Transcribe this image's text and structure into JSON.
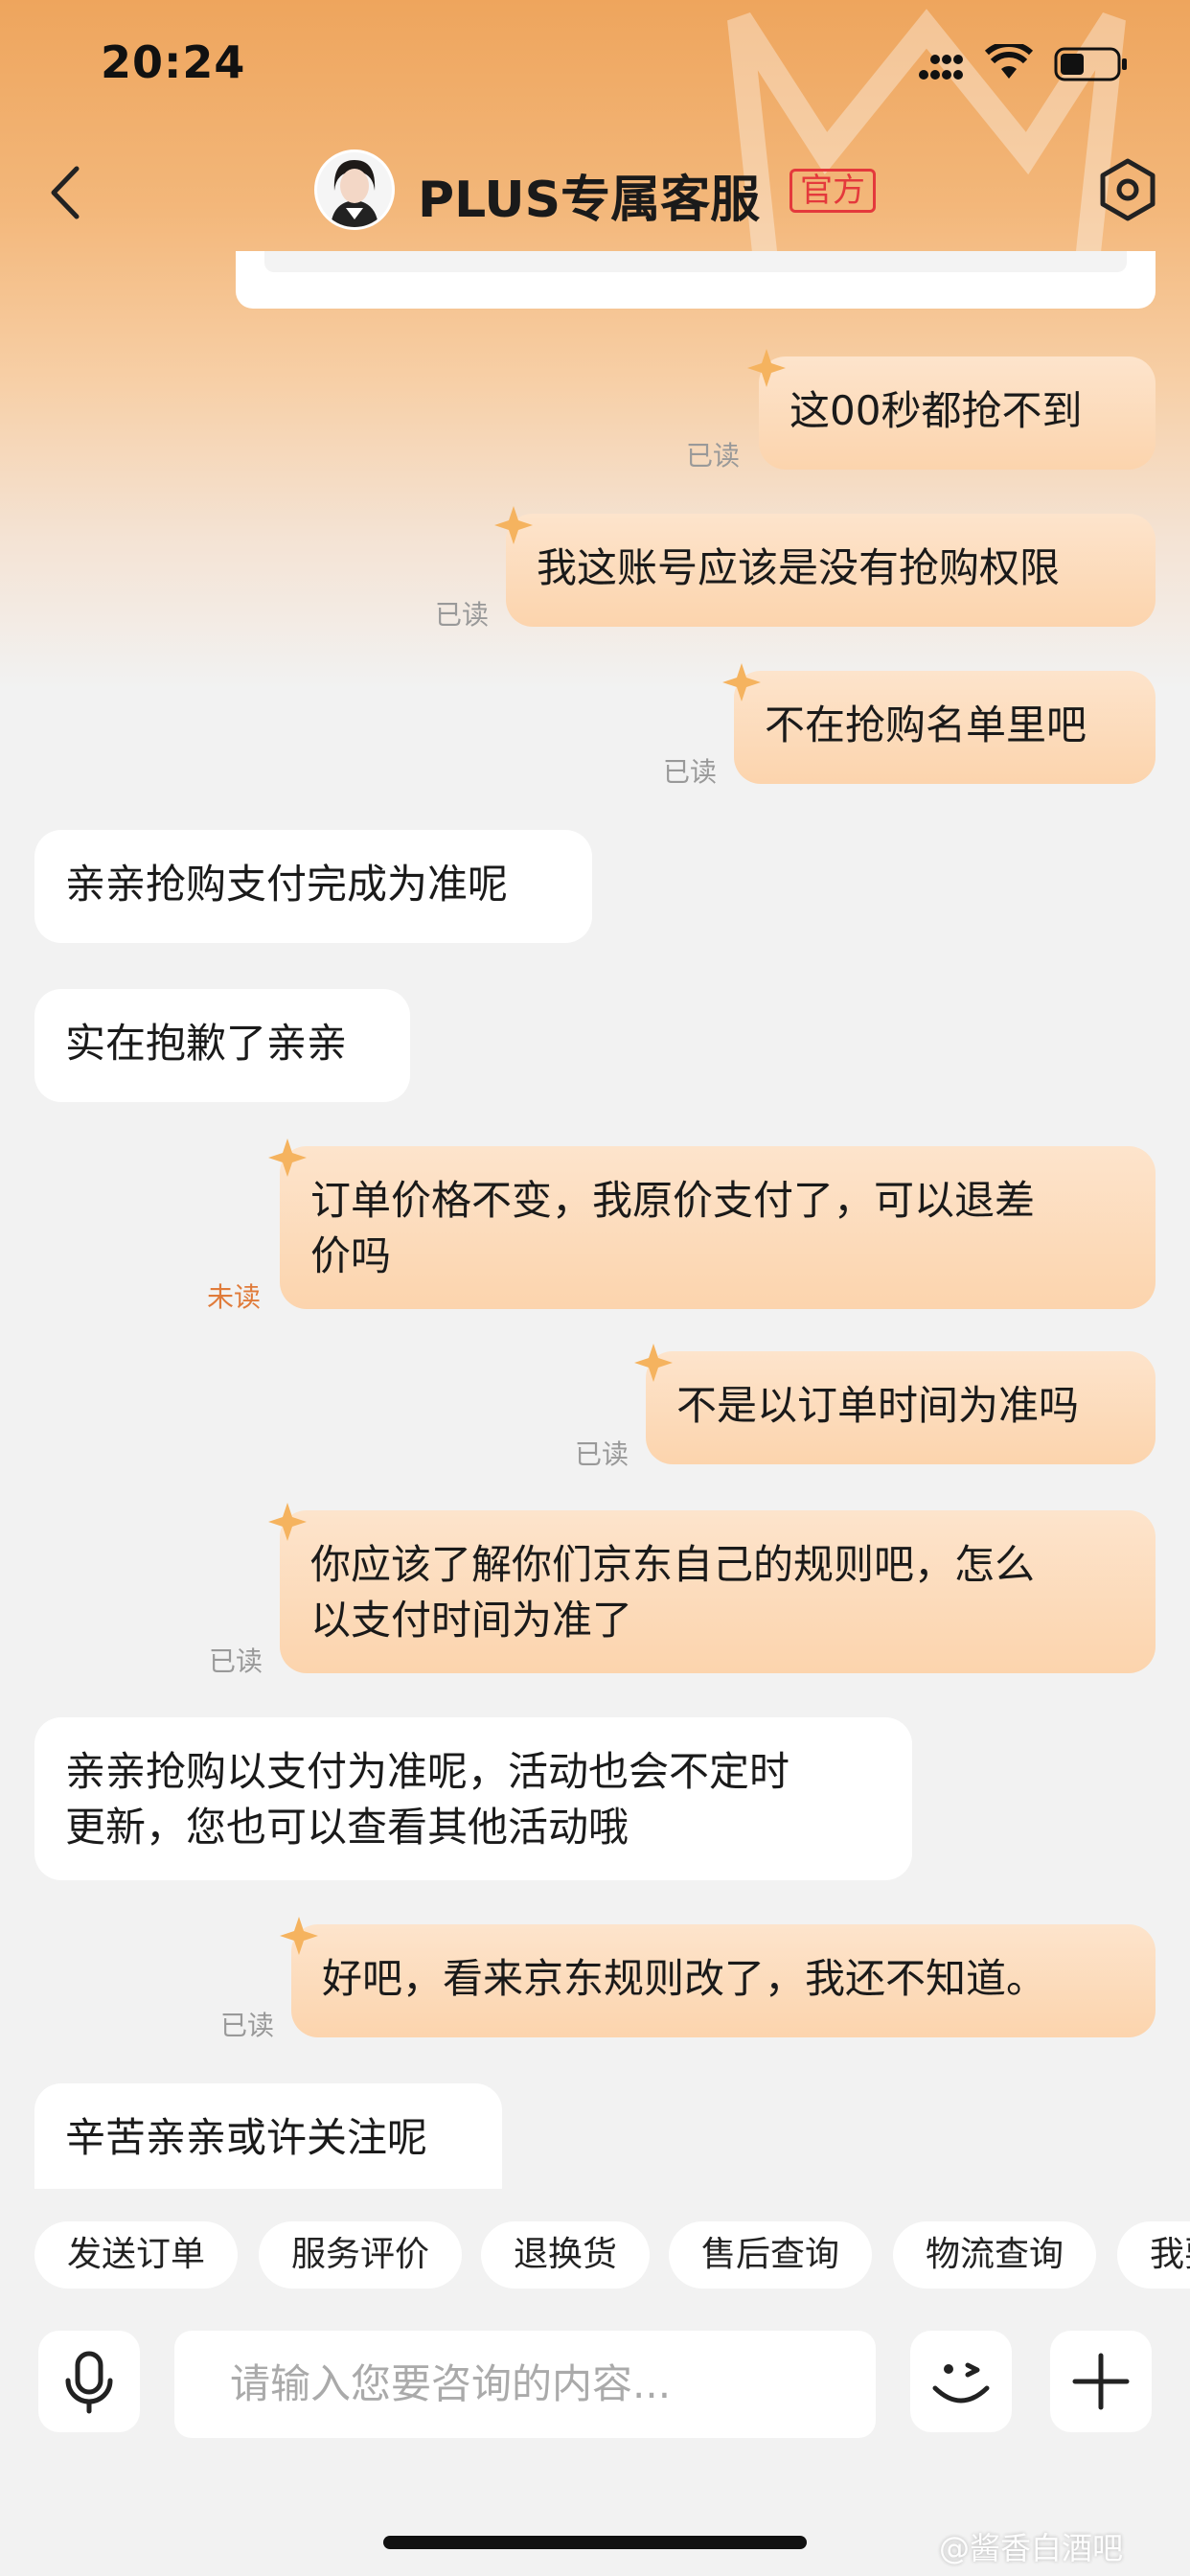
{
  "status_bar": {
    "time": "20:24"
  },
  "header": {
    "title": "PLUS专属客服",
    "badge": "官方"
  },
  "messages": [
    {
      "text": "这00秒都抢不到",
      "status": "已读"
    },
    {
      "text": "我这账号应该是没有抢购权限",
      "status": "已读"
    },
    {
      "text": "不在抢购名单里吧",
      "status": "已读"
    },
    {
      "text": "亲亲抢购支付完成为准呢"
    },
    {
      "text": "实在抱歉了亲亲"
    },
    {
      "line1": "订单价格不变，我原价支付了，可以退差",
      "line2": "价吗",
      "status": "未读"
    },
    {
      "text": "不是以订单时间为准吗",
      "status": "已读"
    },
    {
      "line1": "你应该了解你们京东自己的规则吧，怎么",
      "line2": "以支付时间为准了",
      "status": "已读"
    },
    {
      "line1": "亲亲抢购以支付为准呢，活动也会不定时",
      "line2": "更新，您也可以查看其他活动哦"
    },
    {
      "text": "好吧，看来京东规则改了，我还不知道。",
      "status": "已读"
    },
    {
      "text": "辛苦亲亲或许关注呢"
    }
  ],
  "quick_actions": [
    "发送订单",
    "服务评价",
    "退换货",
    "售后查询",
    "物流查询",
    "我要"
  ],
  "input": {
    "placeholder": "请输入您要咨询的内容..."
  },
  "watermark": "@酱香白酒吧",
  "colors": {
    "accent": "#f3a35a",
    "outgoing_bubble": "#fcd9b6",
    "badge": "#e4393c",
    "unread": "#e07b3a"
  }
}
